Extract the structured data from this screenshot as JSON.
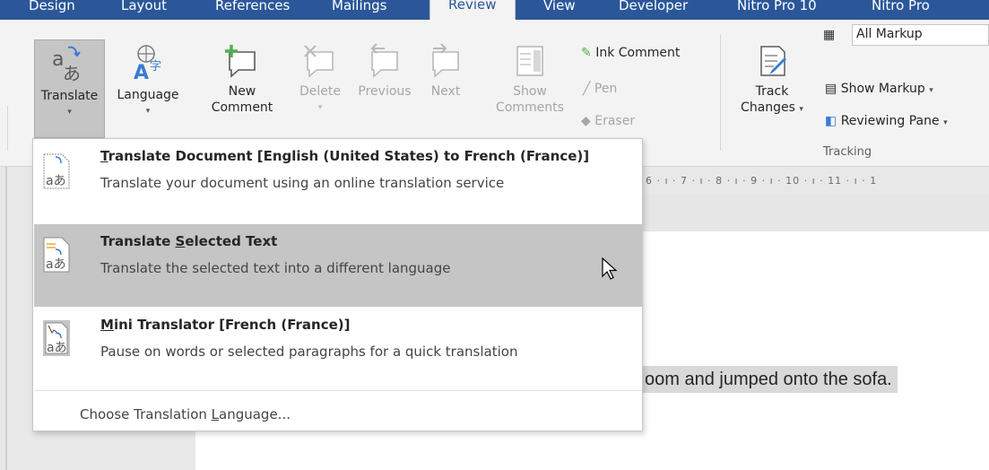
{
  "tabs": [
    {
      "label": "Design"
    },
    {
      "label": "Layout"
    },
    {
      "label": "References"
    },
    {
      "label": "Mailings"
    },
    {
      "label": "Review"
    },
    {
      "label": "View"
    },
    {
      "label": "Developer"
    },
    {
      "label": "Nitro Pro 10"
    },
    {
      "label": "Nitro Pro"
    }
  ],
  "ribbon": {
    "translate": "Translate",
    "language": "Language",
    "new_comment_1": "New",
    "new_comment_2": "Comment",
    "delete": "Delete",
    "previous": "Previous",
    "next": "Next",
    "show_comments_1": "Show",
    "show_comments_2": "Comments",
    "ink_comment": "Ink Comment",
    "pen": "Pen",
    "eraser": "Eraser",
    "track_changes_1": "Track",
    "track_changes_2": "Changes",
    "all_markup": "All Markup",
    "show_markup": "Show Markup",
    "reviewing_pane": "Reviewing Pane",
    "tracking_group": "Tracking"
  },
  "ruler": "6 · ı · 7 · ı · 8 · ı · 9 · ı · 10 · ı · 11 · ı · 1",
  "document": {
    "visible_text": "oom and jumped onto the sofa."
  },
  "menu": {
    "items": [
      {
        "title": "Translate Document [English (United States) to French (France)]",
        "desc": "Translate your document using an online translation service",
        "ul_char": "T"
      },
      {
        "title_pre": "Translate ",
        "title_ul": "S",
        "title_post": "elected Text",
        "desc": "Translate the selected text into a different language"
      },
      {
        "title_ul": "M",
        "title_post": "ini Translator [French (France)]",
        "desc": "Pause on words or selected paragraphs for a quick translation"
      }
    ],
    "footer_pre": "Choose Translation ",
    "footer_ul": "L",
    "footer_post": "anguage..."
  },
  "colors": {
    "tab_bar": "#2b579a",
    "ribbon": "#f3f3f3",
    "highlight": "#c5c5c5",
    "accent_green": "#4caf50"
  }
}
